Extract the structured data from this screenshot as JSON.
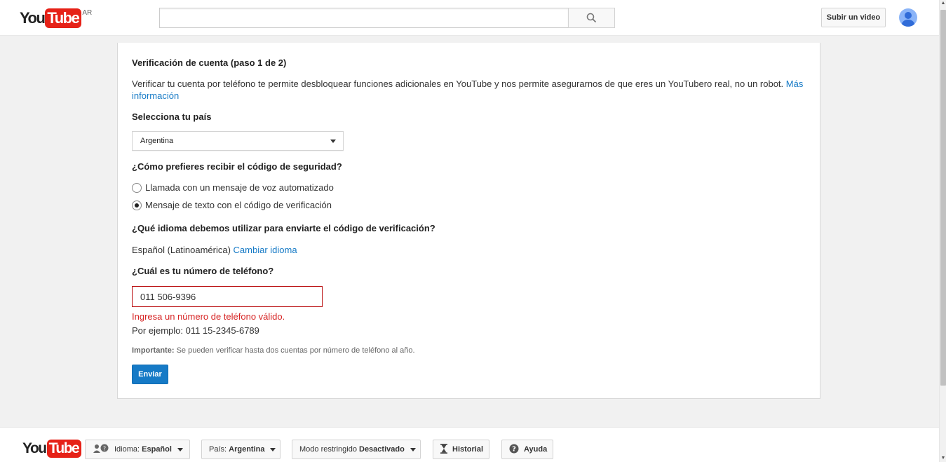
{
  "header": {
    "logo_you": "You",
    "logo_tube": "Tube",
    "country_code": "AR",
    "search_placeholder": "",
    "upload_label": "Subir un video"
  },
  "card": {
    "title": "Verificación de cuenta (paso 1 de 2)",
    "intro_text": "Verificar tu cuenta por teléfono te permite desbloquear funciones adicionales en YouTube y nos permite asegurarnos de que eres un YouTubero real, no un robot.",
    "more_info_line1": "Más",
    "more_info_line2": "información",
    "country_label": "Selecciona tu país",
    "country_value": "Argentina",
    "method_label": "¿Cómo prefieres recibir el código de seguridad?",
    "method_options": [
      {
        "label": "Llamada con un mensaje de voz automatizado",
        "checked": false
      },
      {
        "label": "Mensaje de texto con el código de verificación",
        "checked": true
      }
    ],
    "language_label": "¿Qué idioma debemos utilizar para enviarte el código de verificación?",
    "language_value": "Español (Latinoamérica)",
    "change_language_link": "Cambiar idioma",
    "phone_label": "¿Cuál es tu número de teléfono?",
    "phone_value": "011 506-9396",
    "phone_error": "Ingresa un número de teléfono válido.",
    "phone_example": "Por ejemplo: 011 15-2345-6789",
    "note_bold": "Importante:",
    "note_text": "Se pueden verificar hasta dos cuentas por número de teléfono al año.",
    "submit_label": "Enviar"
  },
  "footer": {
    "logo_you": "You",
    "logo_tube": "Tube",
    "language_prefix": "Idioma:",
    "language_value": "Español",
    "country_prefix": "País:",
    "country_value": "Argentina",
    "restricted_prefix": "Modo restringido",
    "restricted_value": "Desactivado",
    "history_label": "Historial",
    "help_label": "Ayuda"
  }
}
